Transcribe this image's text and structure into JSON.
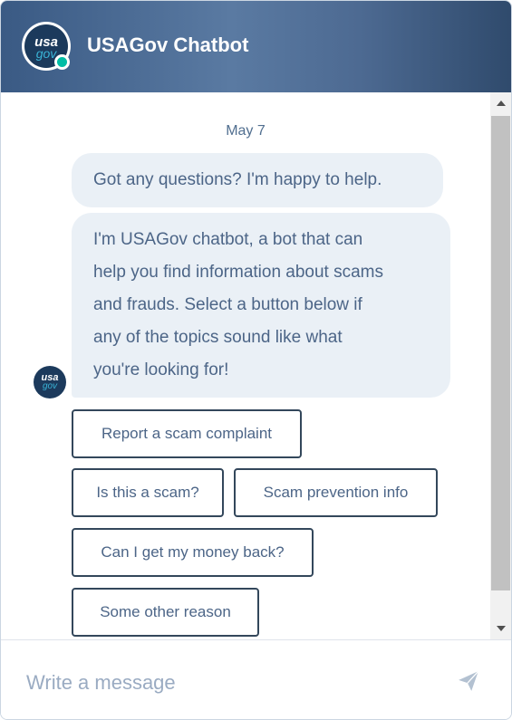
{
  "header": {
    "title": "USAGov Chatbot",
    "logo_text_top": "usa",
    "logo_text_bottom": "gov",
    "status": "online"
  },
  "conversation": {
    "date": "May 7",
    "messages": [
      {
        "sender": "bot",
        "lines": [
          "Got any questions? I'm happy to help."
        ]
      },
      {
        "sender": "bot",
        "lines": [
          "I'm USAGov chatbot, a bot that can",
          "help you find information about scams",
          "and frauds. Select a button below if",
          "any of the topics sound like what",
          "you're looking for!"
        ]
      }
    ],
    "quick_replies": [
      "Report a scam complaint",
      "Is this a scam?",
      "Scam prevention info",
      "Can I get my money back?",
      "Some other reason"
    ]
  },
  "composer": {
    "placeholder": "Write a message",
    "value": ""
  },
  "colors": {
    "header_start": "#3a5a84",
    "header_end": "#2f4a6c",
    "bubble_bg": "#eaf0f6",
    "bubble_text": "#4c6587",
    "status_dot": "#00bda5",
    "button_border": "#33475b"
  },
  "icons": {
    "send": "paper-plane-icon",
    "scroll_up": "arrow-up-icon",
    "scroll_down": "arrow-down-icon"
  }
}
